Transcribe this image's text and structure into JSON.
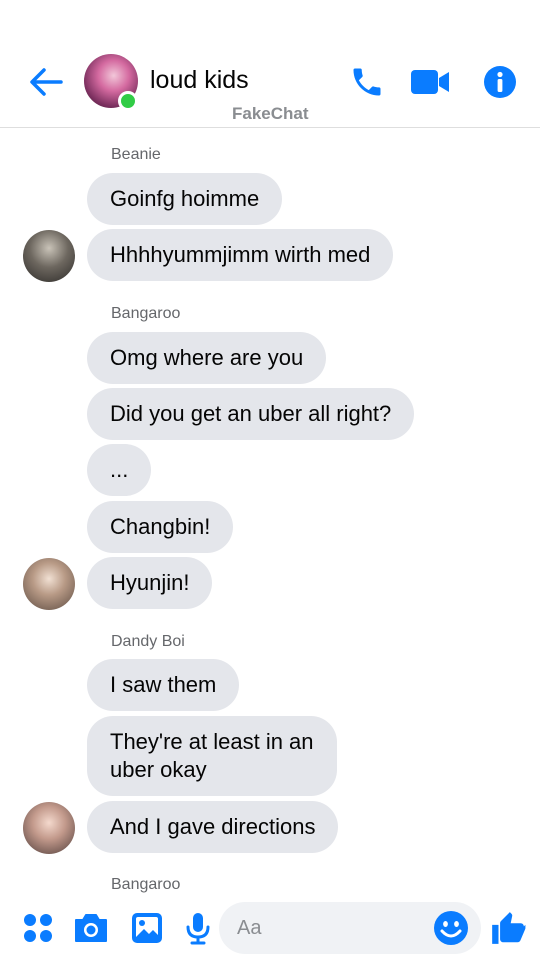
{
  "header": {
    "title": "loud kids",
    "watermark": "FakeChat",
    "accent": "#0a7cff",
    "online_color": "#31cc46"
  },
  "messages": [
    {
      "sender": "Beanie",
      "bubbles": [
        "Goinfg hoimme",
        "Hhhhyummjimm wirth med"
      ]
    },
    {
      "sender": "Bangaroo",
      "bubbles": [
        "Omg where are you",
        "Did you get an uber all right?",
        "...",
        "Changbin!",
        "Hyunjin!"
      ]
    },
    {
      "sender": "Dandy Boi",
      "bubbles": [
        "I saw them",
        "They're at least in an\nuber okay",
        "And I gave directions"
      ]
    },
    {
      "sender": "Bangaroo",
      "bubbles": []
    }
  ],
  "composer": {
    "placeholder": "Aa",
    "icons": [
      "menu-dots-icon",
      "camera-icon",
      "gallery-icon",
      "microphone-icon",
      "emoji-icon",
      "thumbs-up-icon"
    ]
  }
}
